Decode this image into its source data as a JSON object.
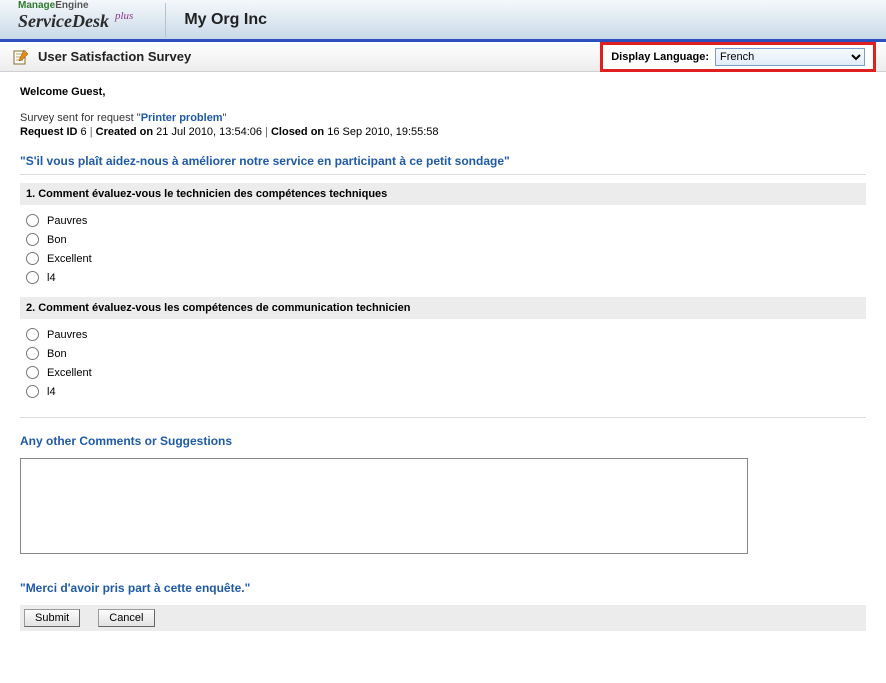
{
  "header": {
    "brand_top_manage": "Manage",
    "brand_top_engine": "Engine",
    "brand_sd": "ServiceDesk",
    "brand_plus": "plus",
    "org": "My Org Inc"
  },
  "titlebar": {
    "title": "User Satisfaction Survey",
    "lang_label": "Display Language:",
    "lang_value": "French"
  },
  "welcome": "Welcome Guest,",
  "meta": {
    "sent_prefix": "Survey sent for request \"",
    "request_title": "Printer problem",
    "sent_suffix": "\"",
    "request_id_label": "Request ID",
    "request_id": "6",
    "created_label": "Created on",
    "created": "21 Jul 2010, 13:54:06",
    "closed_label": "Closed on",
    "closed": "16 Sep 2010, 19:55:58"
  },
  "intro": "\"S'il vous plaît aidez-nous à améliorer notre service en participant à ce petit sondage\"",
  "questions": [
    {
      "text": "1. Comment évaluez-vous le technicien des compétences techniques",
      "options": [
        "Pauvres",
        "Bon",
        "Excellent",
        "l4"
      ]
    },
    {
      "text": "2. Comment évaluez-vous les compétences de communication technicien",
      "options": [
        "Pauvres",
        "Bon",
        "Excellent",
        "l4"
      ]
    }
  ],
  "comments_heading": "Any other Comments or Suggestions",
  "thanks": "\"Merci d'avoir pris part à cette enquête.\"",
  "actions": {
    "submit": "Submit",
    "cancel": "Cancel"
  }
}
